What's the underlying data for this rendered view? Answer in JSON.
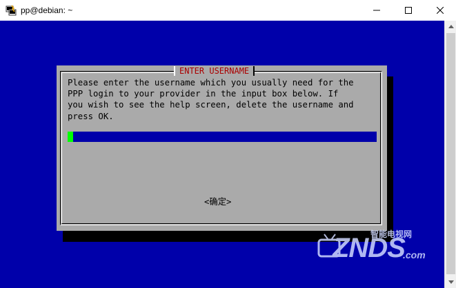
{
  "window": {
    "title": "pp@debian: ~",
    "icons": {
      "app": "putty-icon",
      "minimize": "minimize-icon",
      "maximize": "maximize-icon",
      "close": "close-icon"
    }
  },
  "colors": {
    "terminal_bg": "#0000aa",
    "dialog_bg": "#aaaaaa",
    "dialog_title": "#aa0000",
    "cursor": "#00ff00"
  },
  "dialog": {
    "title": "ENTER USERNAME",
    "message_lines": [
      "Please enter the username which you usually need for the",
      "PPP login to your provider in the input box below. If",
      "you wish to see the help screen, delete the username and",
      "press OK."
    ],
    "input_value": "",
    "ok_label": "<确定>"
  },
  "watermark": {
    "brand": "ZNDS",
    "suffix": ".com",
    "chinese": "智能电视网"
  }
}
